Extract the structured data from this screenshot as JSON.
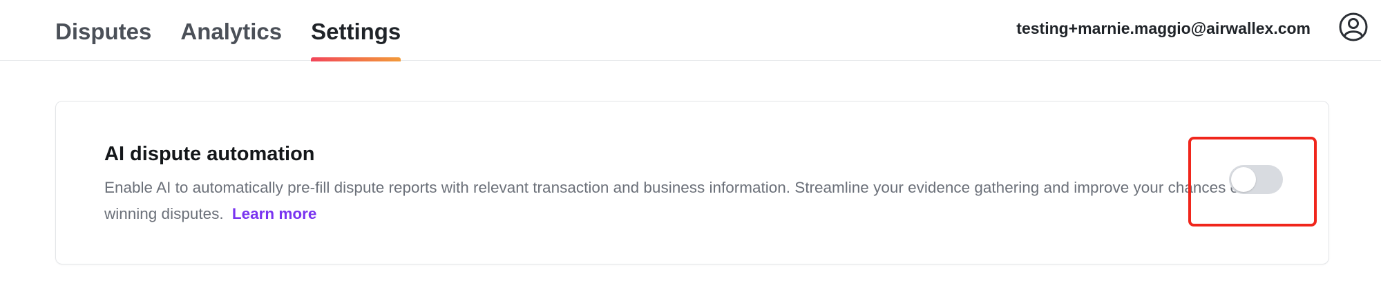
{
  "nav": {
    "tabs": [
      {
        "label": "Disputes",
        "active": false
      },
      {
        "label": "Analytics",
        "active": false
      },
      {
        "label": "Settings",
        "active": true
      }
    ],
    "user_email": "testing+marnie.maggio@airwallex.com",
    "avatar_icon": "user-circle-icon"
  },
  "setting": {
    "title": "AI dispute automation",
    "description": "Enable AI to automatically pre-fill dispute reports with relevant transaction and business information. Streamline your evidence gathering and improve your chances of winning disputes.",
    "link_label": "Learn more",
    "toggle_enabled": false
  },
  "colors": {
    "accent_gradient_start": "#f2455a",
    "accent_gradient_end": "#f29a3a",
    "link": "#7a34f0",
    "toggle_off": "#d8dbe0",
    "highlight_box": "#f0261c"
  }
}
